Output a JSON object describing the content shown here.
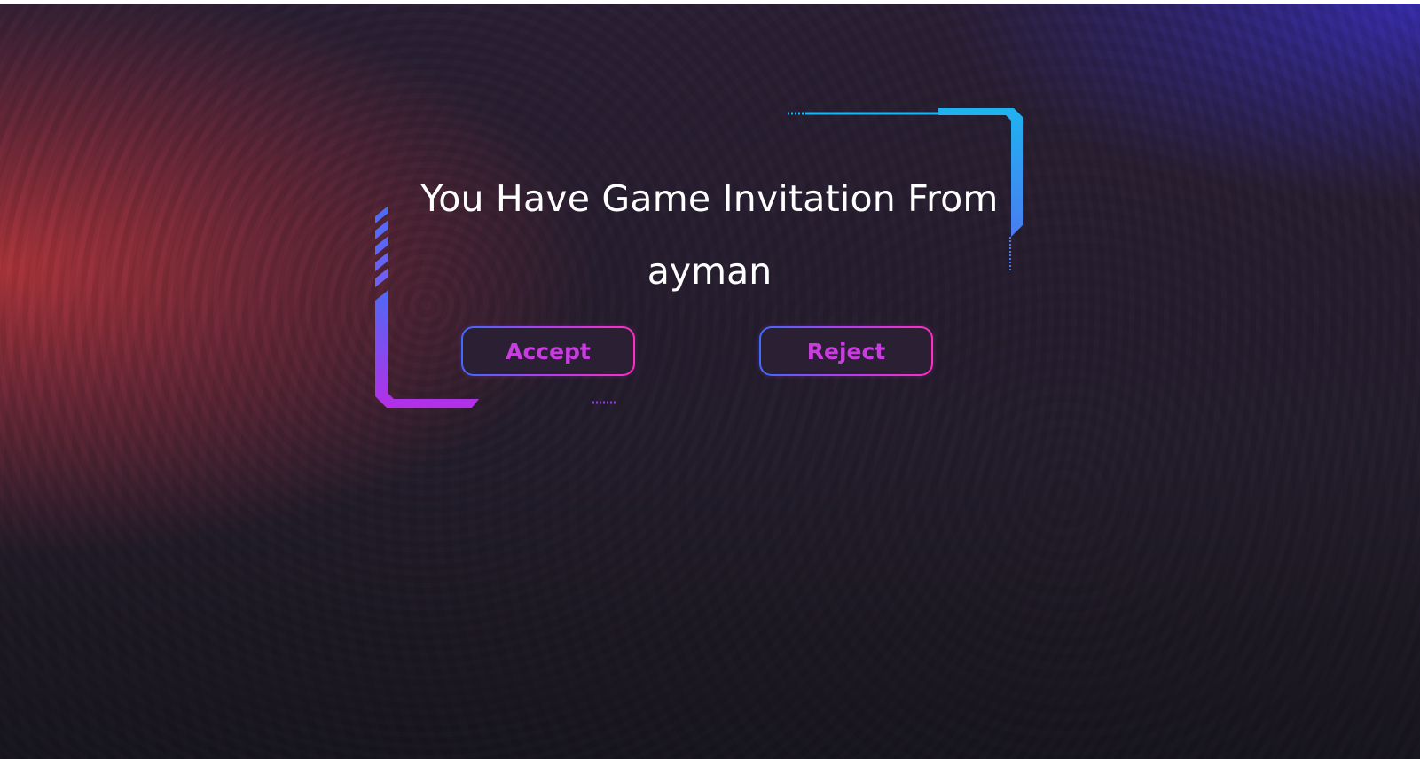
{
  "invitation": {
    "title": "You Have Game Invitation From",
    "inviter": "ayman"
  },
  "actions": {
    "accept_label": "Accept",
    "reject_label": "Reject"
  },
  "colors": {
    "text": "#ffffff",
    "button_text": "#c93de0",
    "frame_blue": "#1fb3f0",
    "frame_purple": "#b52ee8",
    "button_border_start": "#3b6cff",
    "button_border_end": "#ff2fc0"
  },
  "icons": {
    "frame_top_right": "hud-corner-bracket",
    "frame_bottom_left": "hud-corner-bracket"
  }
}
